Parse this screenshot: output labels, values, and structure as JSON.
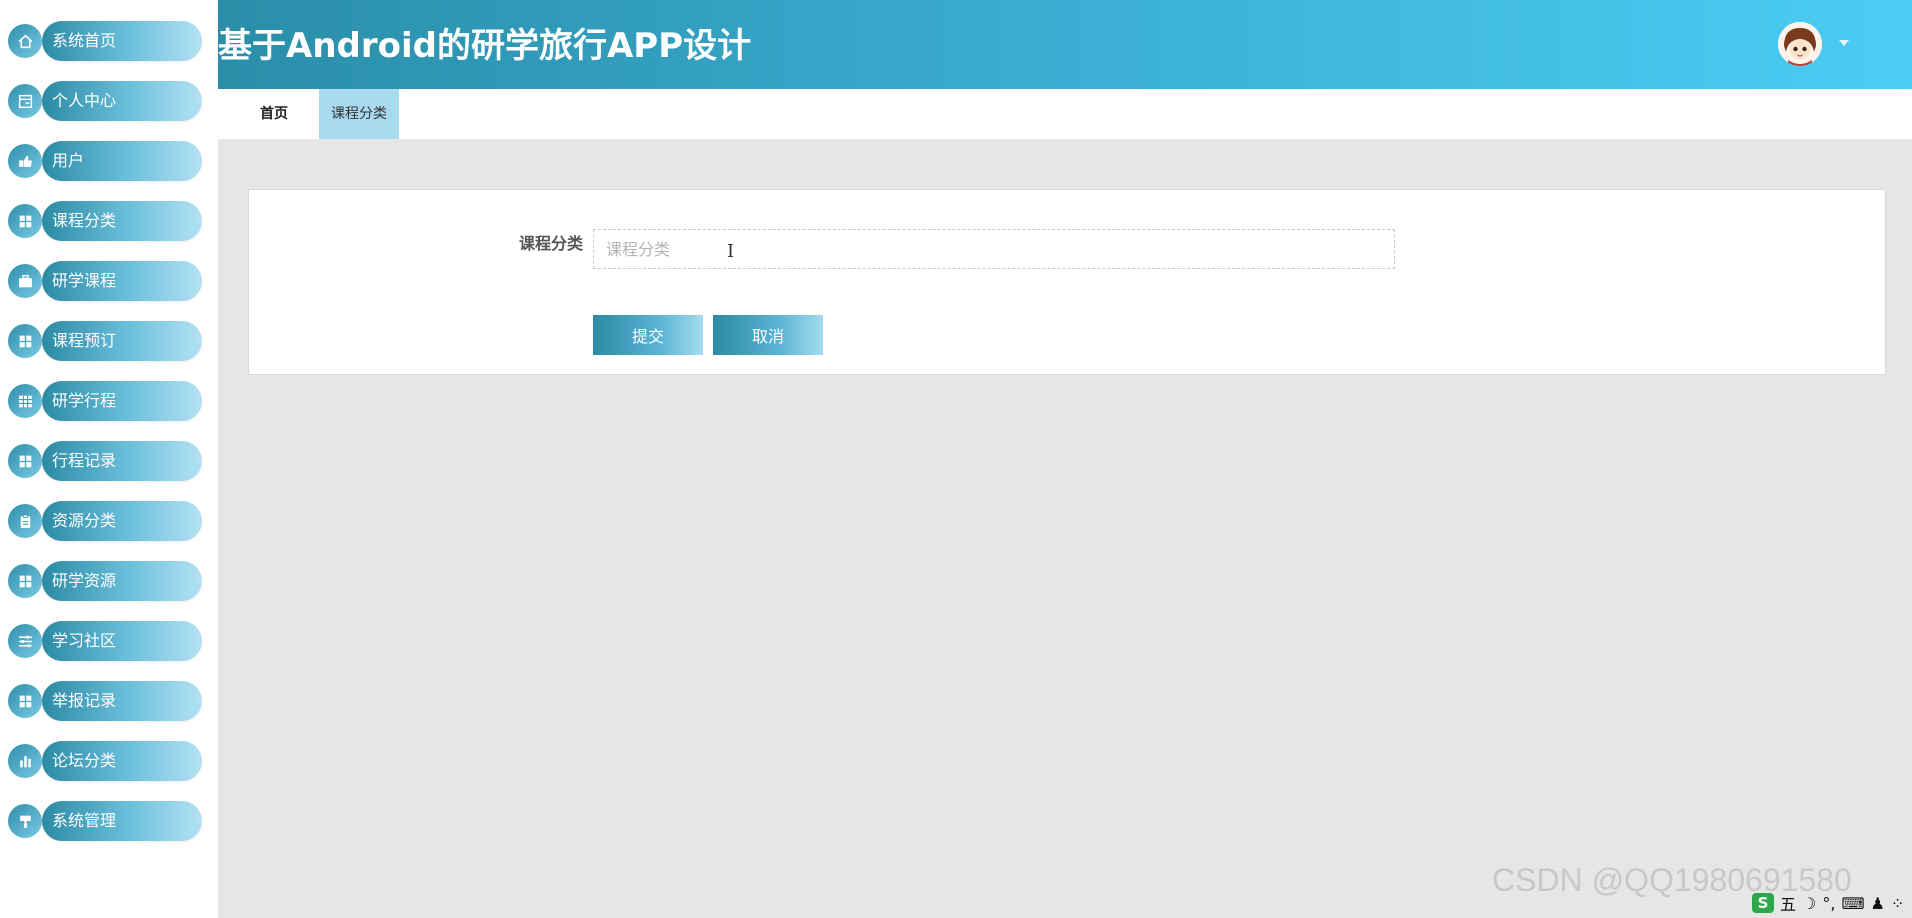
{
  "header": {
    "title": "基于Android的研学旅行APP设计",
    "avatar_icon": "user-avatar",
    "dropdown_icon": "caret-down-icon"
  },
  "sidebar": {
    "items": [
      {
        "label": "系统首页",
        "icon": "home-icon"
      },
      {
        "label": "个人中心",
        "icon": "profile-icon"
      },
      {
        "label": "用户",
        "icon": "user-icon"
      },
      {
        "label": "课程分类",
        "icon": "grid-icon"
      },
      {
        "label": "研学课程",
        "icon": "briefcase-icon"
      },
      {
        "label": "课程预订",
        "icon": "grid-icon"
      },
      {
        "label": "研学行程",
        "icon": "table-icon"
      },
      {
        "label": "行程记录",
        "icon": "grid-icon"
      },
      {
        "label": "资源分类",
        "icon": "clipboard-icon"
      },
      {
        "label": "研学资源",
        "icon": "grid-icon"
      },
      {
        "label": "学习社区",
        "icon": "sliders-icon"
      },
      {
        "label": "举报记录",
        "icon": "grid-icon"
      },
      {
        "label": "论坛分类",
        "icon": "bar-chart-icon"
      },
      {
        "label": "系统管理",
        "icon": "paint-roller-icon"
      }
    ]
  },
  "tabs": {
    "home": "首页",
    "active": "课程分类"
  },
  "form": {
    "label": "课程分类",
    "placeholder": "课程分类",
    "value": "",
    "submit_label": "提交",
    "cancel_label": "取消"
  },
  "overlay": {
    "text_cursor": "I",
    "watermark": "CSDN @QQ1980691580",
    "ime_mode": "五"
  },
  "colors": {
    "accent_dark": "#2b8aa4",
    "accent_light": "#4ccdf4",
    "active_tab": "#a9daf0",
    "page_bg": "#e6e6e6"
  }
}
